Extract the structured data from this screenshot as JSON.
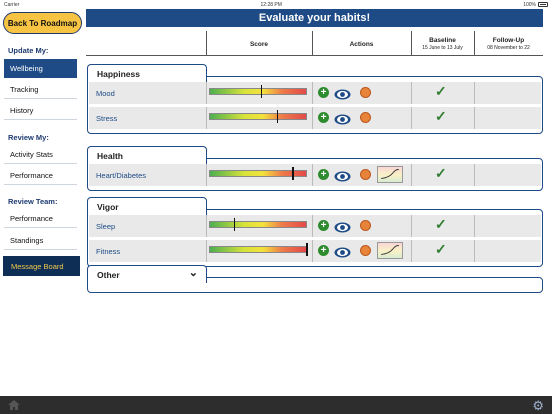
{
  "status": {
    "carrier": "Carrier",
    "time": "12:28 PM",
    "battery": "100%"
  },
  "sidebar": {
    "back_label": "Back To Roadmap",
    "update_head": "Update My:",
    "update_items": [
      "Wellbeing",
      "Tracking",
      "History"
    ],
    "review_head": "Review My:",
    "review_items": [
      "Activity Stats",
      "Performance"
    ],
    "team_head": "Review Team:",
    "team_items": [
      "Performance",
      "Standings"
    ],
    "message_board": "Message Board"
  },
  "main": {
    "title": "Evaluate your habits!",
    "columns": {
      "score": "Score",
      "actions": "Actions",
      "baseline": "Baseline",
      "baseline_range": "15 June to 13 July",
      "followup": "Follow-Up",
      "followup_range": "08 November to 22"
    },
    "groups": [
      {
        "name": "Happiness",
        "rows": [
          {
            "label": "Mood",
            "score": 0.53,
            "trend": false,
            "baseline": "✓"
          },
          {
            "label": "Stress",
            "score": 0.69,
            "trend": false,
            "baseline": "✓"
          }
        ]
      },
      {
        "name": "Health",
        "rows": [
          {
            "label": "Heart/Diabetes",
            "score": 0.85,
            "trend": true,
            "baseline": "✓"
          }
        ]
      },
      {
        "name": "Vigor",
        "rows": [
          {
            "label": "Sleep",
            "score": 0.25,
            "trend": false,
            "baseline": "✓"
          },
          {
            "label": "Fitness",
            "score": 0.99,
            "trend": true,
            "baseline": "✓"
          }
        ]
      },
      {
        "name": "Other",
        "rows": []
      }
    ]
  },
  "colors": {
    "brand": "#1e4b85",
    "accent": "#f6c343",
    "check": "#2f7d2f"
  },
  "icons": {
    "add": "plus-icon",
    "view": "eye-icon",
    "info": "book-icon",
    "trend": "trend-chart-icon",
    "home": "home-icon",
    "settings": "gear-icon",
    "expand": "chevron-down-icon"
  }
}
